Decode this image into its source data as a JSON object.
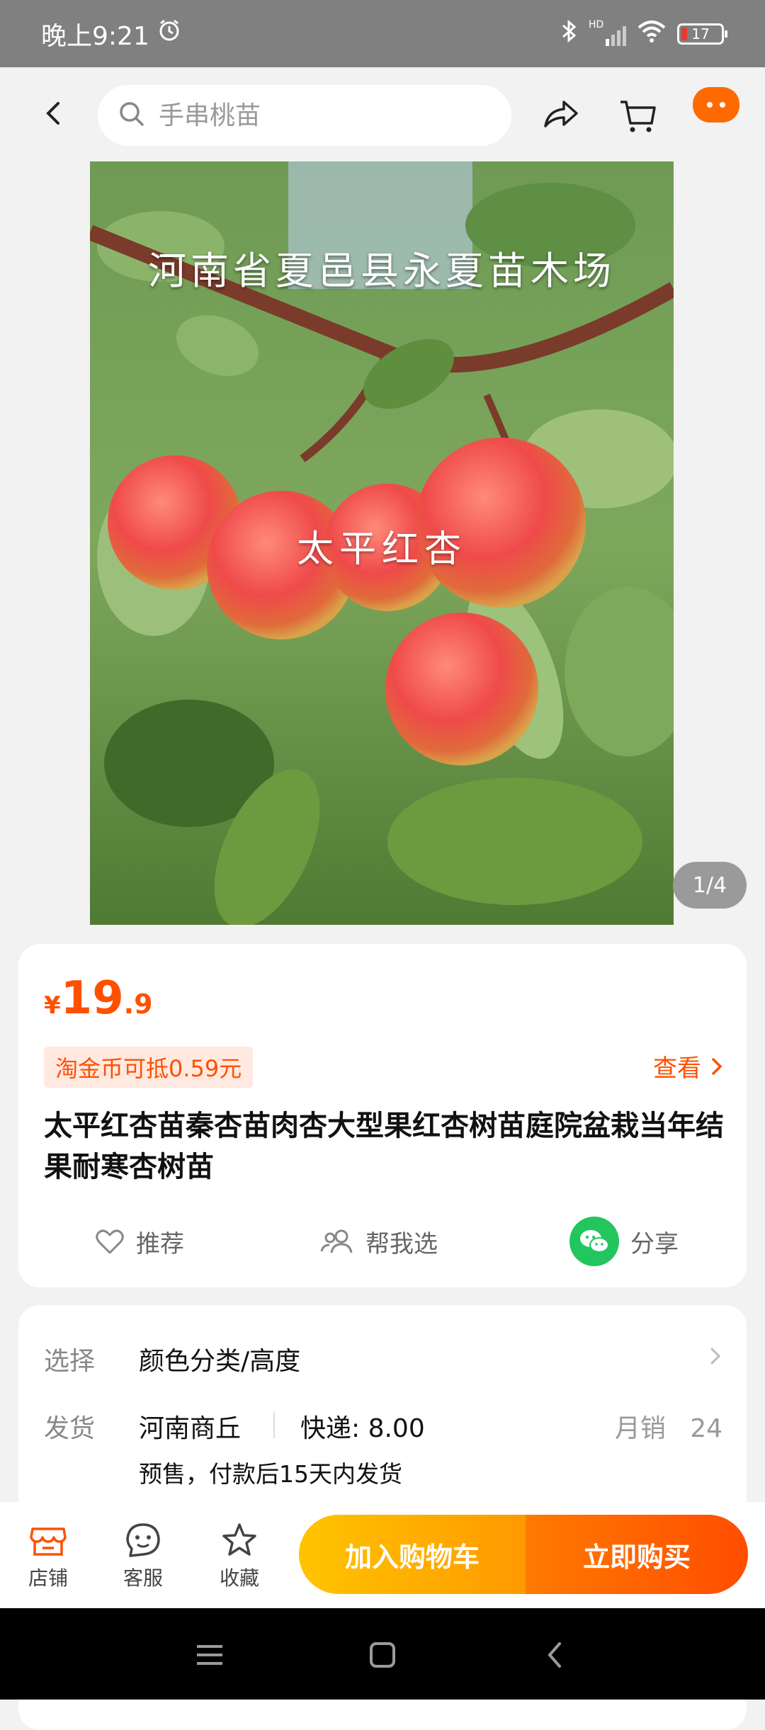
{
  "status_bar": {
    "time": "晚上9:21",
    "network": "HD",
    "battery": "17"
  },
  "header": {
    "search_placeholder": "手串桃苗"
  },
  "hero": {
    "caption_top": "河南省夏邑县永夏苗木场",
    "caption_mid": "太平红杏",
    "page_indicator": "1/4"
  },
  "product": {
    "currency": "¥",
    "price_int": "19",
    "price_dec": ".9",
    "coin_offer": "淘金币可抵0.59元",
    "view_link": "查看",
    "title": "太平红杏苗秦杏苗肉杏大型果红杏树苗庭院盆栽当年结果耐寒杏树苗",
    "actions": {
      "recommend": "推荐",
      "help_choose": "帮我选",
      "share": "分享"
    }
  },
  "spec": {
    "select_label": "选择",
    "select_value": "颜色分类/高度",
    "ship_label": "发货",
    "ship_origin": "河南商丘",
    "ship_fee": "快递: 8.00",
    "monthly_label": "月销",
    "monthly_value": "24",
    "ship_note": "预售，付款后15天内发货"
  },
  "bottom_bar": {
    "store": "店铺",
    "service": "客服",
    "favorite": "收藏",
    "add_to_cart": "加入购物车",
    "buy_now": "立即购买"
  },
  "colors": {
    "accent": "#ff5000",
    "cart_button": "#ffb300",
    "buy_button": "#ff5a00",
    "wechat": "#22c55e"
  }
}
